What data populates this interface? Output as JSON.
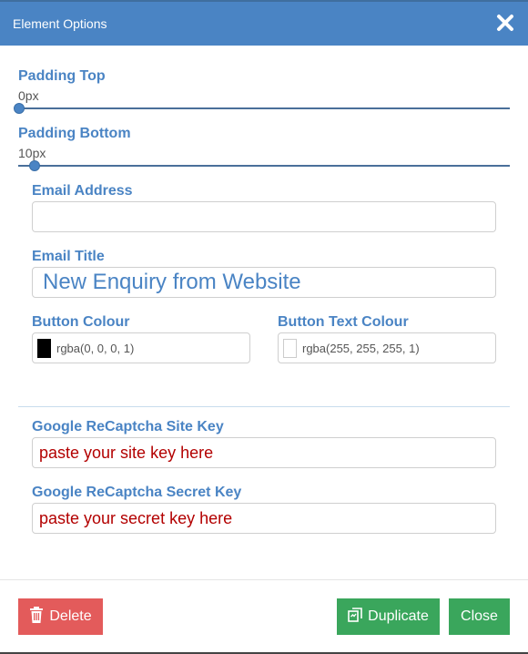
{
  "header": {
    "title": "Element Options",
    "close_icon": "close-icon"
  },
  "padding_top": {
    "label": "Padding Top",
    "value_text": "0px",
    "value": 0
  },
  "padding_bottom": {
    "label": "Padding Bottom",
    "value_text": "10px",
    "value": 10
  },
  "email_address": {
    "label": "Email Address",
    "value": ""
  },
  "email_title": {
    "label": "Email Title",
    "value": "New Enquiry from Website"
  },
  "button_colour": {
    "label": "Button Colour",
    "value": "rgba(0, 0, 0, 1)",
    "swatch": "#000000"
  },
  "button_text_colour": {
    "label": "Button Text Colour",
    "value": "rgba(255, 255, 255, 1)",
    "swatch": "#ffffff"
  },
  "recaptcha_site_key": {
    "label": "Google ReCaptcha Site Key",
    "value": "paste your site key here"
  },
  "recaptcha_secret_key": {
    "label": "Google ReCaptcha Secret Key",
    "value": "paste your secret key here"
  },
  "footer": {
    "delete_label": "Delete",
    "duplicate_label": "Duplicate",
    "close_label": "Close"
  },
  "colors": {
    "accent": "#4a84c4",
    "danger": "#e35b5b",
    "success": "#3aa65c",
    "key_text": "#b30000"
  }
}
